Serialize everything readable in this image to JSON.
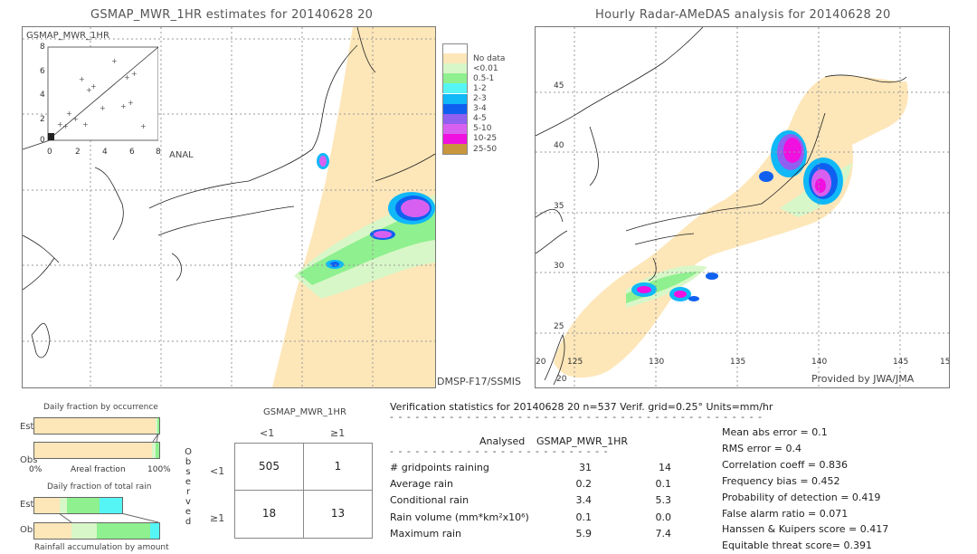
{
  "left_panel": {
    "title": "GSMAP_MWR_1HR estimates for 20140628 20",
    "inset_title": "GSMAP_MWR_1HR",
    "inset_x_label": "ANAL",
    "inset_y_ticks": [
      "8",
      "6",
      "4",
      "2",
      "0"
    ],
    "inset_x_ticks": [
      "0",
      "2",
      "4",
      "6",
      "8"
    ],
    "sensor_label": "DMSP-F17/SSMIS"
  },
  "right_panel": {
    "title": "Hourly Radar-AMeDAS analysis for 20140628 20",
    "lat_ticks": [
      "45",
      "40",
      "35",
      "30",
      "25"
    ],
    "lon_ticks": [
      "20",
      "125",
      "130",
      "135",
      "140",
      "145",
      "15"
    ],
    "bottom_lat_label": "20",
    "credit": "Provided by JWA/JMA"
  },
  "legend": {
    "items": [
      {
        "label": "",
        "color": "#ffffff"
      },
      {
        "label": "No data",
        "color": "#fde6b8"
      },
      {
        "label": "<0.01",
        "color": "#d8f7c8"
      },
      {
        "label": "0.5-1",
        "color": "#8ef08e"
      },
      {
        "label": "1-2",
        "color": "#55f5f5"
      },
      {
        "label": "2-3",
        "color": "#10b8f8"
      },
      {
        "label": "3-4",
        "color": "#1060f0"
      },
      {
        "label": "4-5",
        "color": "#9060f0"
      },
      {
        "label": "5-10",
        "color": "#d860f0"
      },
      {
        "label": "10-25",
        "color": "#f010e0"
      },
      {
        "label": "25-50",
        "color": "#c8963c"
      }
    ]
  },
  "occurrence_chart": {
    "title": "Daily fraction by occurrence",
    "est_label": "Est",
    "obs_label": "Obs",
    "axis_left": "0%",
    "axis_mid": "Areal fraction",
    "axis_right": "100%",
    "est_fractions": [
      {
        "color": "#fde6b8",
        "value": 0.974
      },
      {
        "color": "#d8f7c8",
        "value": 0.01
      },
      {
        "color": "#8ef08e",
        "value": 0.016
      }
    ],
    "obs_fractions": [
      {
        "color": "#fde6b8",
        "value": 0.942
      },
      {
        "color": "#d8f7c8",
        "value": 0.03
      },
      {
        "color": "#8ef08e",
        "value": 0.028
      }
    ]
  },
  "total_rain_chart": {
    "title": "Daily fraction of total rain",
    "est_label": "Est",
    "obs_label": "Obs",
    "footer": "Rainfall accumulation by amount",
    "est_scale": 0.7,
    "est_fractions": [
      {
        "color": "#fde6b8",
        "value": 0.29
      },
      {
        "color": "#d8f7c8",
        "value": 0.08
      },
      {
        "color": "#8ef08e",
        "value": 0.37
      },
      {
        "color": "#55f5f5",
        "value": 0.26
      }
    ],
    "obs_fractions": [
      {
        "color": "#fde6b8",
        "value": 0.3
      },
      {
        "color": "#d8f7c8",
        "value": 0.2
      },
      {
        "color": "#8ef08e",
        "value": 0.43
      },
      {
        "color": "#55f5f5",
        "value": 0.07
      }
    ]
  },
  "contingency": {
    "model_label": "GSMAP_MWR_1HR",
    "col_headers": [
      "<1",
      "≥1"
    ],
    "row_headers": [
      "<1",
      "≥1"
    ],
    "observed_label": [
      "O",
      "b",
      "s",
      "e",
      "r",
      "v",
      "e",
      "d"
    ],
    "cells": [
      [
        "505",
        "1"
      ],
      [
        "18",
        "13"
      ]
    ]
  },
  "verification": {
    "header": "Verification statistics for 20140628 20   n=537   Verif. grid=0.25°   Units=mm/hr",
    "col_analysed": "Analysed",
    "col_model": "GSMAP_MWR_1HR",
    "rows": [
      {
        "label": "# gridpoints raining",
        "analysed": "31",
        "model": "14"
      },
      {
        "label": "Average rain",
        "analysed": "0.2",
        "model": "0.1"
      },
      {
        "label": "Conditional rain",
        "analysed": "3.4",
        "model": "5.3"
      },
      {
        "label": "Rain volume (mm*km²x10⁶)",
        "analysed": "0.1",
        "model": "0.0"
      },
      {
        "label": "Maximum rain",
        "analysed": "5.9",
        "model": "7.4"
      }
    ],
    "scores": [
      "Mean abs error = 0.1",
      "RMS error = 0.4",
      "Correlation coeff = 0.836",
      "Frequency bias = 0.452",
      "Probability of detection = 0.419",
      "False alarm ratio = 0.071",
      "Hanssen & Kuipers score = 0.417",
      "Equitable threat score= 0.391"
    ]
  }
}
